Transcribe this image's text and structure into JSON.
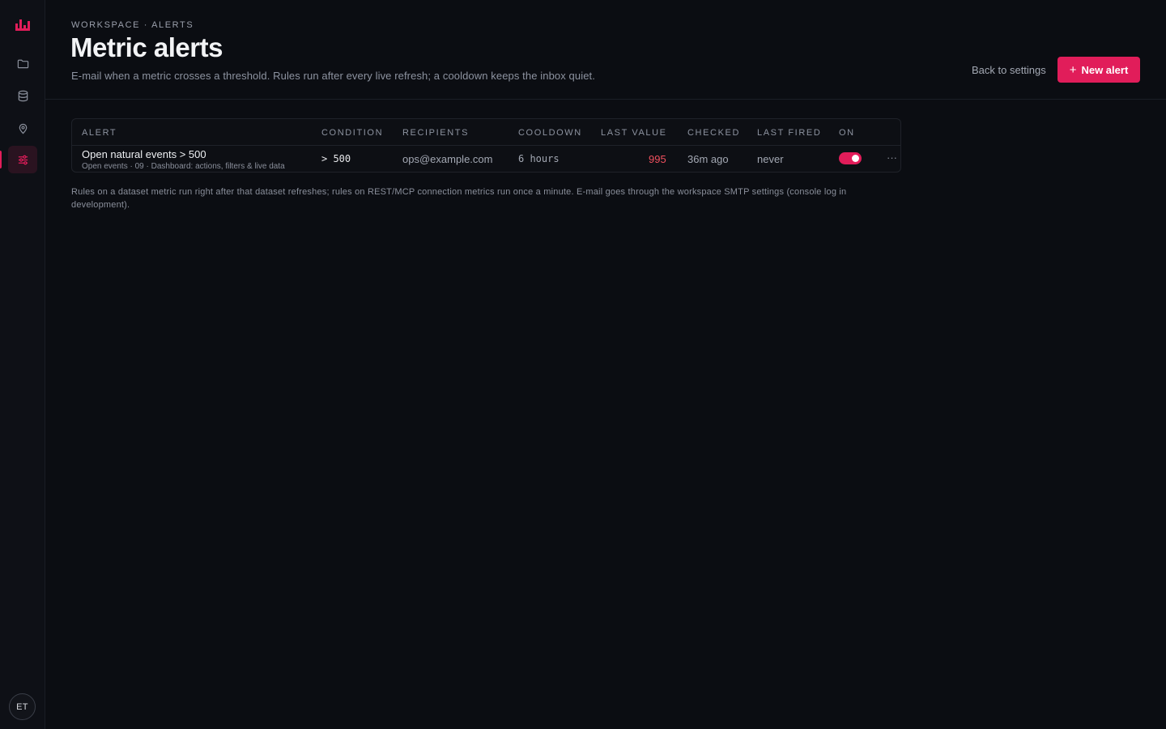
{
  "sidebar": {
    "items": [
      {
        "name": "projects",
        "icon": "folder-icon"
      },
      {
        "name": "datasets",
        "icon": "database-icon"
      },
      {
        "name": "maps",
        "icon": "map-pin-icon"
      },
      {
        "name": "settings",
        "icon": "sliders-icon",
        "active": true
      }
    ],
    "user_initials": "ET"
  },
  "header": {
    "breadcrumb": "WORKSPACE · ALERTS",
    "title": "Metric alerts",
    "subtitle": "E-mail when a metric crosses a threshold. Rules run after every live refresh; a cooldown keeps the inbox quiet.",
    "back_label": "Back to settings",
    "new_alert_label": "New alert"
  },
  "table": {
    "columns": [
      "ALERT",
      "CONDITION",
      "RECIPIENTS",
      "COOLDOWN",
      "LAST VALUE",
      "CHECKED",
      "LAST FIRED",
      "ON"
    ],
    "rows": [
      {
        "name": "Open natural events > 500",
        "subtitle": "Open events · 09 · Dashboard: actions, filters & live data",
        "condition": "> 500",
        "recipients": "ops@example.com",
        "cooldown": "6 hours",
        "last_value": "995",
        "checked": "36m ago",
        "last_fired": "never",
        "enabled": true,
        "menu": "···"
      }
    ]
  },
  "footnote": "Rules on a dataset metric run right after that dataset refreshes; rules on REST/MCP connection metrics run once a minute. E-mail goes through the workspace SMTP settings (console log in development).",
  "colors": {
    "accent": "#e11d5a",
    "background": "#0b0d12",
    "alert_value": "#f0505e"
  }
}
